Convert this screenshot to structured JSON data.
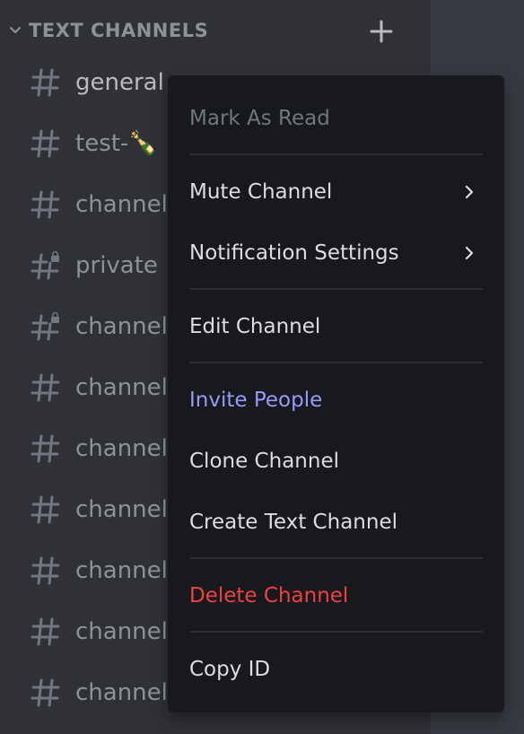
{
  "sidebar": {
    "category_label": "TEXT CHANNELS",
    "channels": [
      {
        "name": "general",
        "locked": false
      },
      {
        "name": "test-🍾",
        "locked": false
      },
      {
        "name": "channel",
        "locked": false
      },
      {
        "name": "private",
        "locked": true
      },
      {
        "name": "channel",
        "locked": true
      },
      {
        "name": "channel",
        "locked": false
      },
      {
        "name": "channel",
        "locked": false
      },
      {
        "name": "channel",
        "locked": false
      },
      {
        "name": "channel",
        "locked": false
      },
      {
        "name": "channel",
        "locked": false
      },
      {
        "name": "channel",
        "locked": false
      }
    ]
  },
  "context_menu": {
    "mark_as_read": "Mark As Read",
    "mute_channel": "Mute Channel",
    "notification_settings": "Notification Settings",
    "edit_channel": "Edit Channel",
    "invite_people": "Invite People",
    "clone_channel": "Clone Channel",
    "create_text_channel": "Create Text Channel",
    "delete_channel": "Delete Channel",
    "copy_id": "Copy ID"
  },
  "colors": {
    "sidebar_bg": "#2f3136",
    "menu_bg": "#18191c",
    "invite_accent": "#949cf7",
    "danger": "#ed4245"
  },
  "icons": {
    "category_toggle": "chevron-down-icon",
    "add_channel": "plus-icon",
    "channel": "hash-icon",
    "locked_channel": "hash-lock-icon",
    "submenu": "chevron-right-icon"
  }
}
